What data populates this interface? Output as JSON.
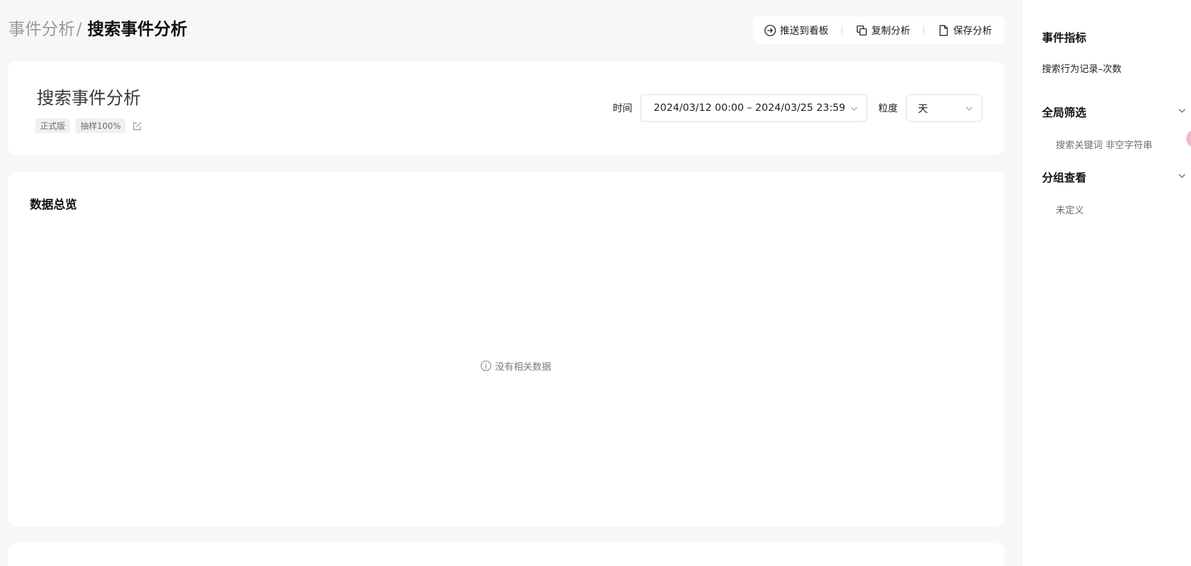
{
  "breadcrumb": {
    "parent": "事件分析",
    "separator": "/",
    "current": "搜索事件分析"
  },
  "toolbar": {
    "push_label": "推送到看板",
    "copy_label": "复制分析",
    "save_label": "保存分析"
  },
  "header": {
    "title": "搜索事件分析",
    "tags": [
      "正式版",
      "抽样100%"
    ],
    "time_label": "时间",
    "date_range": "2024/03/12 00:00 – 2024/03/25 23:59",
    "granularity_label": "粒度",
    "granularity_value": "天"
  },
  "overview": {
    "title": "数据总览",
    "empty_text": "没有相关数据"
  },
  "sidebar": {
    "metrics_title": "事件指标",
    "metric_item": "搜索行为记录–次数",
    "filter_title": "全局筛选",
    "filter_item": "搜索关键词 非空字符串",
    "group_title": "分组查看",
    "group_item": "未定义"
  },
  "colors": {
    "background": "#f7f7f7",
    "card": "#ffffff",
    "muted_text": "#9a9a9a",
    "accent_dot": "#f2b8cf"
  }
}
